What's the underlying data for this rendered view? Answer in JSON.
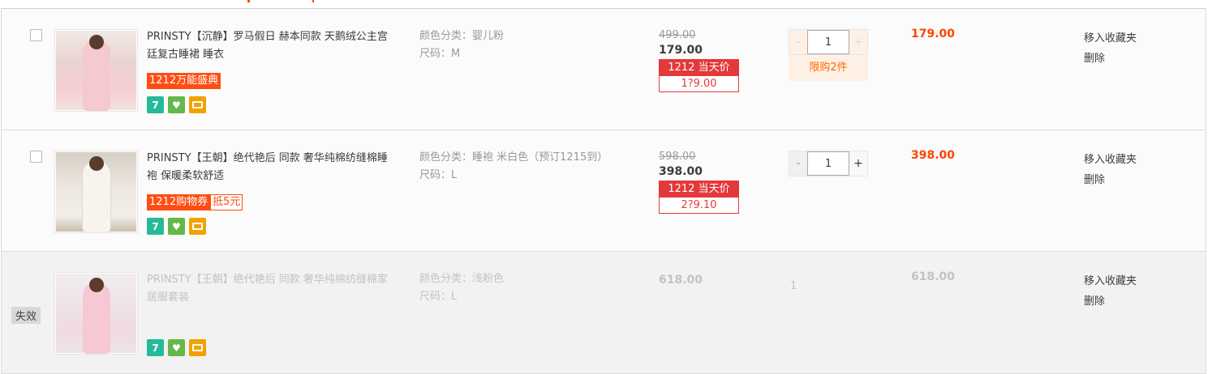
{
  "items": [
    {
      "title": "PRINSTY【沉静】罗马假日 赫本同款 天鹅绒公主宫廷复古睡裙 睡衣",
      "promo_main": "1212万能盛典",
      "promo_extra": "",
      "sku_color": "颜色分类：婴儿粉",
      "sku_size": "尺码：M",
      "old_price": "499.00",
      "price": "179.00",
      "deal_title": "1212 当天价",
      "deal_value": "1?9.00",
      "quantity": "1",
      "limit_text": "限购2件",
      "subtotal": "179.00",
      "fav_label": "移入收藏夹",
      "delete_label": "删除"
    },
    {
      "title": "PRINSTY【王朝】绝代艳后 同款 奢华纯棉纺缝棉睡袍 保暖柔软舒适",
      "promo_main": "1212购物券",
      "promo_extra": "抵5元",
      "sku_color": "颜色分类：睡袍 米白色（预订1215到）",
      "sku_size": "尺码：L",
      "old_price": "598.00",
      "price": "398.00",
      "deal_title": "1212 当天价",
      "deal_value": "2?9.10",
      "quantity": "1",
      "subtotal": "398.00",
      "fav_label": "移入收藏夹",
      "delete_label": "删除"
    },
    {
      "invalid_tag": "失效",
      "title": "PRINSTY【王朝】绝代艳后 同款 奢华纯棉纺缝棉家居服套装",
      "sku_color": "颜色分类：浅粉色",
      "sku_size": "尺码：L",
      "price": "618.00",
      "quantity": "1",
      "subtotal": "618.00",
      "fav_label": "移入收藏夹",
      "delete_label": "删除"
    }
  ],
  "qty_minus": "-",
  "qty_plus": "+",
  "icons": [
    "seven-day-return-icon",
    "gift-icon",
    "card-icon"
  ],
  "icon_glyphs": {
    "seven": "7",
    "gift": "♥"
  },
  "colors": {
    "accent": "#ff4400",
    "deal_red": "#e4393c",
    "promo_orange": "#ff4d12"
  }
}
